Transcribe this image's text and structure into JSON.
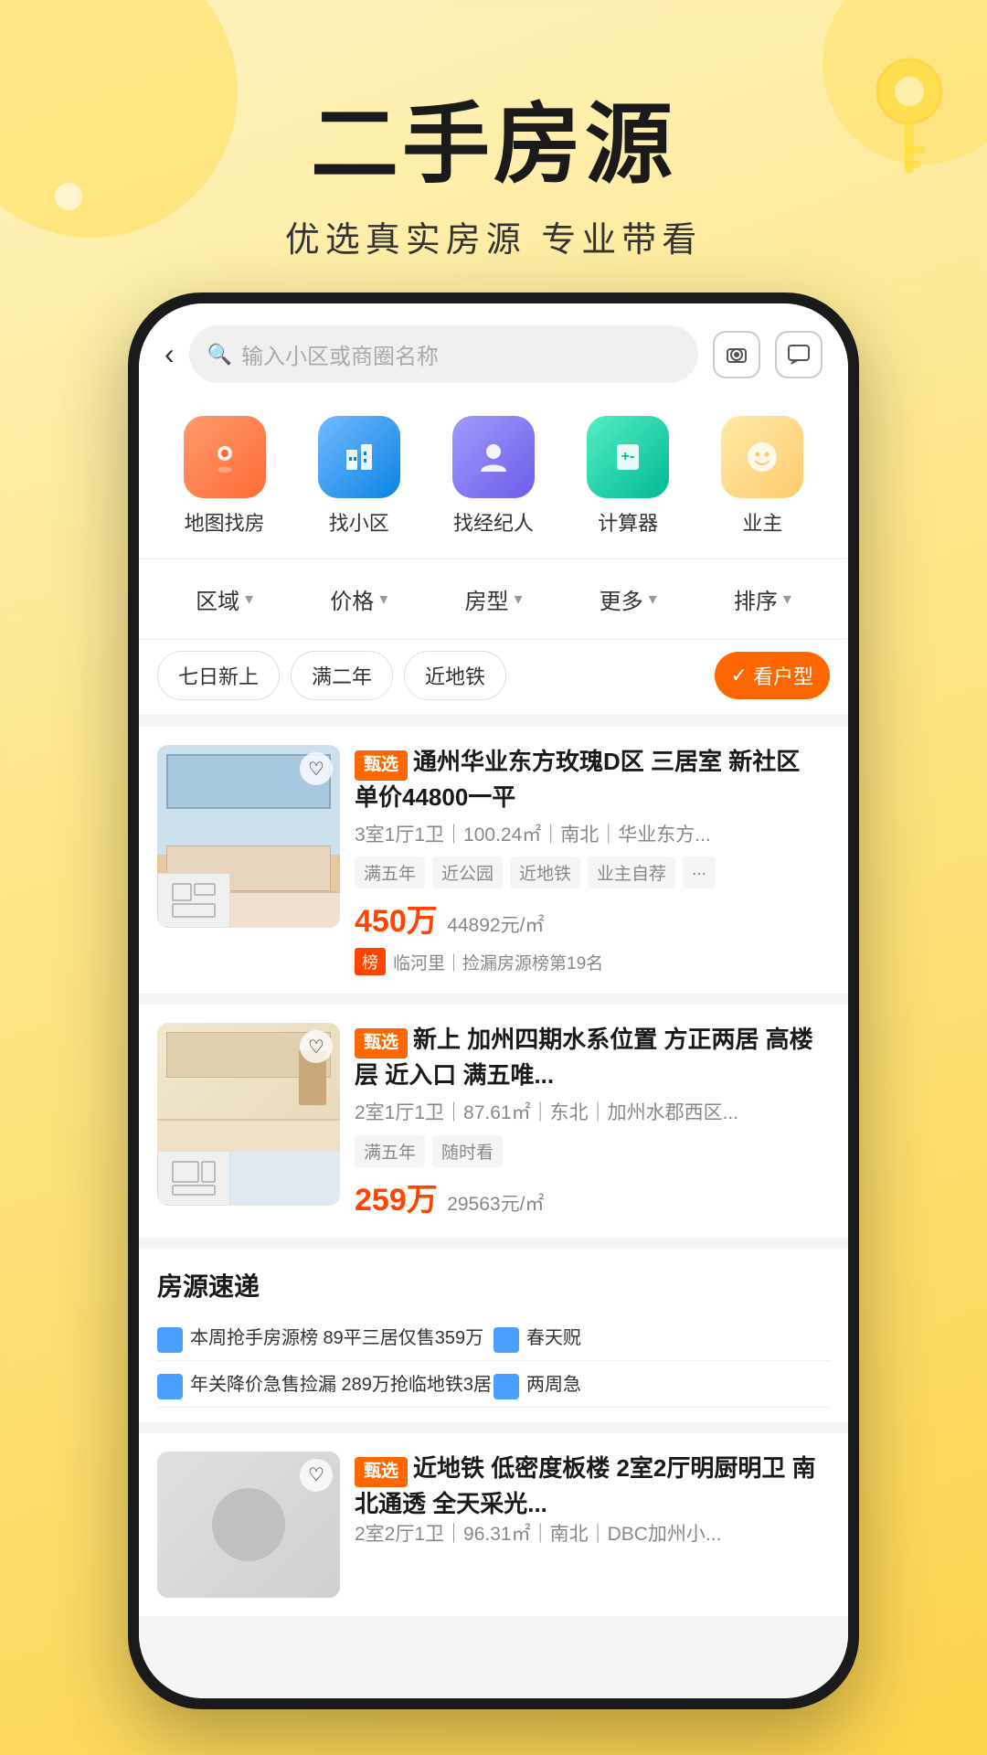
{
  "page": {
    "title": "二手房源",
    "subtitle": "优选真实房源 专业带看"
  },
  "search": {
    "placeholder": "输入小区或商圈名称"
  },
  "quick_nav": {
    "items": [
      {
        "id": "map",
        "label": "地图找房",
        "icon": "📍",
        "color": "orange"
      },
      {
        "id": "community",
        "label": "找小区",
        "icon": "🏢",
        "color": "blue"
      },
      {
        "id": "agent",
        "label": "找经纪人",
        "icon": "👤",
        "color": "purple"
      },
      {
        "id": "calculator",
        "label": "计算器",
        "icon": "🧮",
        "color": "green"
      },
      {
        "id": "owner",
        "label": "业主",
        "icon": "😊",
        "color": "amber"
      }
    ]
  },
  "filters": {
    "items": [
      {
        "label": "区域",
        "has_arrow": true
      },
      {
        "label": "价格",
        "has_arrow": true
      },
      {
        "label": "房型",
        "has_arrow": true
      },
      {
        "label": "更多",
        "has_arrow": true
      },
      {
        "label": "排序",
        "has_arrow": true
      }
    ]
  },
  "tags": {
    "items": [
      {
        "label": "七日新上",
        "active": false
      },
      {
        "label": "满二年",
        "active": false
      },
      {
        "label": "近地铁",
        "active": false
      }
    ],
    "check_label": "看户型"
  },
  "listings": [
    {
      "id": 1,
      "badge": "甄选",
      "title": "通州华业东方玫瑰D区 三居室 新社区 单价44800一平",
      "meta": "3室1厅1卫｜100.24㎡｜南北｜华业东方...",
      "tags": [
        "满五年",
        "近公园",
        "近地铁",
        "业主自荐",
        "..."
      ],
      "price": "450万",
      "price_unit": "44892元/㎡",
      "rank_label": "榜",
      "rank_text": "临河里｜捡漏房源榜第19名"
    },
    {
      "id": 2,
      "badge": "甄选",
      "title": "新上 加州四期水系位置 方正两居 高楼层 近入口 满五唯...",
      "meta": "2室1厅1卫｜87.61㎡｜东北｜加州水郡西区...",
      "tags": [
        "满五年",
        "随时看"
      ],
      "price": "259万",
      "price_unit": "29563元/㎡",
      "rank_label": "",
      "rank_text": ""
    },
    {
      "id": 3,
      "badge": "甄选",
      "title": "近地铁 低密度板楼 2室2厅明厨明卫 南北通透 全天采光...",
      "meta": "2室2厅1卫｜96.31㎡｜南北｜DBC加州小...",
      "tags": [],
      "price": "",
      "price_unit": "",
      "rank_label": "",
      "rank_text": ""
    }
  ],
  "speed_section": {
    "title": "房源速递",
    "items": [
      {
        "text": "本周抢手房源榜 89平三居仅售359万"
      },
      {
        "text": "春天贶"
      },
      {
        "text": "年关降价急售捡漏 289万抢临地铁3居"
      },
      {
        "text": "两周急"
      }
    ]
  }
}
